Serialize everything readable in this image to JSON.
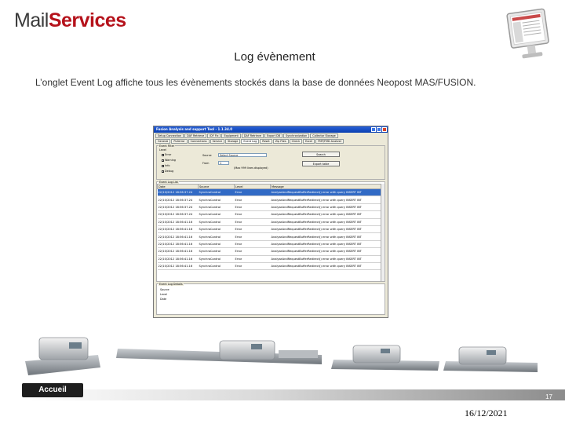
{
  "logo": {
    "part1": "Mail",
    "part2": "Services"
  },
  "slide": {
    "title": "Log évènement",
    "subtitle": "L’onglet Event Log affiche tous les évènements  stockés dans la base de données Neopost MAS/FUSION.",
    "home_label": "Accueil",
    "page_number": "17",
    "date": "16/12/2021"
  },
  "app": {
    "window_title": "Fusion Analysis and support Tool - 1.1.34.0",
    "tabs_row1": [
      "Setup Connection",
      "DAF Retrieve",
      "IDF Fix",
      "Equipment",
      "DAF Retrieve",
      "Export DB",
      "Synchronization",
      "Collector Storage"
    ],
    "tabs_row2": [
      "General",
      "Pullerror",
      "Connections",
      "Service",
      "Storage",
      "Event Log",
      "Reset",
      "Zip Files",
      "Check",
      "Excel",
      "FMF/FMD Analizer"
    ],
    "filter_group": "Event Filter",
    "level_label": "Level",
    "checkboxes": [
      "Error",
      "Warning",
      "Info",
      "Debug"
    ],
    "source_label": "Source",
    "source_value": "Select Source",
    "from_label": "From",
    "from_value": "1",
    "hint": "(Max 999 lines displayed)",
    "search_btn": "Search",
    "export_btn": "Export table",
    "log_group": "Event Log List",
    "columns": [
      "Date",
      "Source",
      "Level",
      "Message"
    ],
    "rows": [
      [
        "22/10/2012 18:56:37.24",
        "SynchroControl",
        "Error",
        "AnalyseAndRequestBufferRedirect() error with query INSERT INT"
      ],
      [
        "22/10/2012 18:56:37.24",
        "SynchroControl",
        "Error",
        "AnalyseAndRequestBufferRedirect() error with query INSERT INT"
      ],
      [
        "22/10/2012 18:56:37.24",
        "SynchroControl",
        "Error",
        "AnalyseAndRequestBufferRedirect() error with query INSERT INT"
      ],
      [
        "22/10/2012 18:56:37.24",
        "SynchroControl",
        "Error",
        "AnalyseAndRequestBufferRedirect() error with query INSERT INT"
      ],
      [
        "22/10/2012 18:56:41.16",
        "SynchroControl",
        "Error",
        "AnalyseAndRequestBufferRedirect() error with query INSERT INT"
      ],
      [
        "22/10/2012 18:56:41.16",
        "SynchroControl",
        "Error",
        "AnalyseAndRequestBufferRedirect() error with query INSERT INT"
      ],
      [
        "22/10/2012 18:56:41.16",
        "SynchroControl",
        "Error",
        "AnalyseAndRequestBufferRedirect() error with query INSERT INT"
      ],
      [
        "22/10/2012 18:56:41.16",
        "SynchroControl",
        "Error",
        "AnalyseAndRequestBufferRedirect() error with query INSERT INT"
      ],
      [
        "22/10/2012 18:56:41.16",
        "SynchroControl",
        "Error",
        "AnalyseAndRequestBufferRedirect() error with query INSERT INT"
      ],
      [
        "22/10/2012 18:56:41.16",
        "SynchroControl",
        "Error",
        "AnalyseAndRequestBufferRedirect() error with query INSERT INT"
      ],
      [
        "22/10/2012 18:56:41.16",
        "SynchroControl",
        "Error",
        "AnalyseAndRequestBufferRedirect() error with query INSERT INT"
      ]
    ],
    "detail_group": "Event Log Details",
    "detail_fields": [
      "Source",
      "Level",
      "Date"
    ]
  },
  "colors": {
    "brand_red": "#b5121b",
    "selection_blue": "#316ac5",
    "titlebar_blue": "#0a3fb0"
  }
}
